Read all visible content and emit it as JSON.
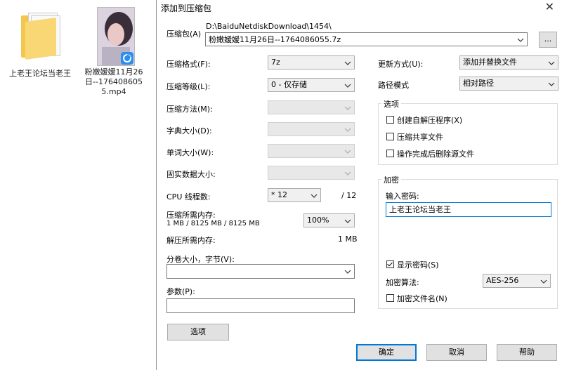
{
  "desktop": {
    "folder_label": "上老王论坛当老王",
    "video_label": "粉嫩嫒嫒11月26日--1764086055.mp4"
  },
  "dialog": {
    "title": "添加到压缩包",
    "close_glyph": "✕",
    "archive": {
      "label": "压缩包(A)",
      "path": "D:\\BaiduNetdiskDownload\\1454\\",
      "name": "粉嫩嫒嫒11月26日--1764086055.7z",
      "browse_label": "..."
    },
    "left": {
      "format_label": "压缩格式(F):",
      "format_value": "7z",
      "level_label": "压缩等级(L):",
      "level_value": "0 - 仅存储",
      "method_label": "压缩方法(M):",
      "dict_label": "字典大小(D):",
      "word_label": "单词大小(W):",
      "solid_label": "固实数据大小:",
      "cpu_label": "CPU 线程数:",
      "cpu_value": "* 12",
      "cpu_total": "/ 12",
      "mem_label": "压缩所需内存:",
      "mem_value": "1 MB / 8125 MB / 8125 MB",
      "mem_percent": "100%",
      "demem_label": "解压所需内存:",
      "demem_value": "1 MB",
      "split_label": "分卷大小，字节(V):",
      "split_value": "",
      "params_label": "参数(P):",
      "params_value": "",
      "options_button": "选项"
    },
    "right": {
      "update_label": "更新方式(U):",
      "update_value": "添加并替换文件",
      "path_label": "路径模式",
      "path_value": "相对路径",
      "options_group": "选项",
      "opt_sfx": "创建自解压程序(X)",
      "opt_shared": "压缩共享文件",
      "opt_delete": "操作完成后删除源文件",
      "enc_group": "加密",
      "pwd_label": "输入密码:",
      "pwd_value": "上老王论坛当老王",
      "show_pwd": "显示密码(S)",
      "show_pwd_checked": true,
      "enc_method_label": "加密算法:",
      "enc_method_value": "AES-256",
      "enc_names": "加密文件名(N)"
    },
    "buttons": {
      "ok": "确定",
      "cancel": "取消",
      "help": "帮助"
    }
  }
}
